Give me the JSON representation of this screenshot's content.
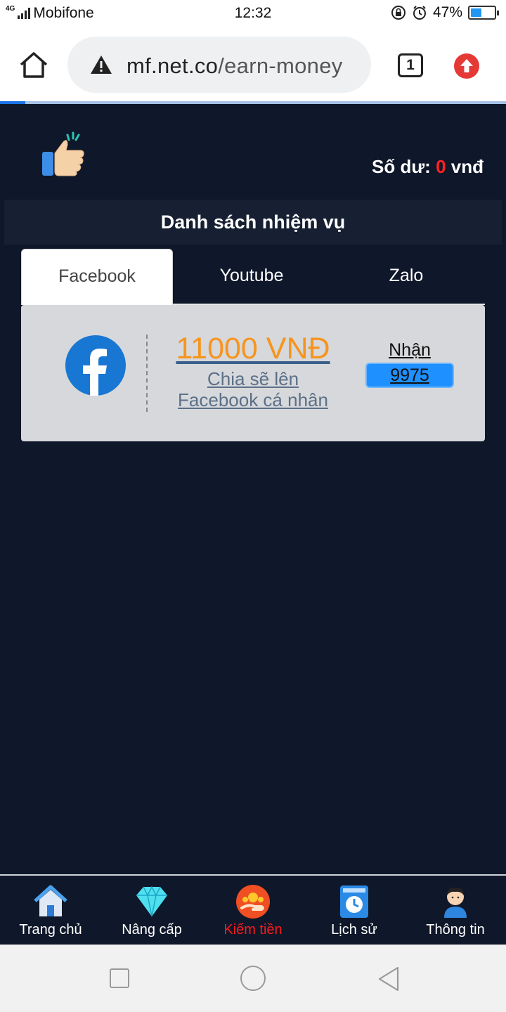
{
  "status_bar": {
    "network_type": "4G",
    "carrier": "Mobifone",
    "time": "12:32",
    "battery_percent": "47%",
    "battery_level": 0.47,
    "icons": [
      "signal-icon",
      "rotation-lock-icon",
      "alarm-icon",
      "battery-icon"
    ]
  },
  "browser": {
    "url_host": "mf.net.co",
    "url_path": "/earn-money",
    "tab_count": "1",
    "icons": [
      "home-icon",
      "not-secure-warning-icon",
      "tab-switcher-icon",
      "update-arrow-icon"
    ]
  },
  "header": {
    "balance_label": "Số dư:",
    "balance_value": "0",
    "balance_unit": "vnđ",
    "logo_icon": "thumbs-up-icon"
  },
  "page": {
    "title": "Danh sách nhiệm vụ"
  },
  "tabs": [
    {
      "label": "Facebook",
      "active": true
    },
    {
      "label": "Youtube",
      "active": false
    },
    {
      "label": "Zalo",
      "active": false
    }
  ],
  "task": {
    "platform_icon": "facebook-icon",
    "reward": "11000 VNĐ",
    "description_line1": "Chia sẽ lên",
    "description_line2": "Facebook cá nhân",
    "receive_label": "Nhận",
    "receive_count": "9975"
  },
  "bottom_nav": [
    {
      "label": "Trang chủ",
      "icon": "house-icon",
      "active": false
    },
    {
      "label": "Nâng cấp",
      "icon": "diamond-icon",
      "active": false
    },
    {
      "label": "Kiếm tiền",
      "icon": "coin-hand-icon",
      "active": true
    },
    {
      "label": "Lịch sử",
      "icon": "history-book-icon",
      "active": false
    },
    {
      "label": "Thông tin",
      "icon": "user-avatar-icon",
      "active": false
    }
  ],
  "colors": {
    "page_bg": "#0f172a",
    "title_bar_bg": "#162032",
    "reward_orange": "#f7941d",
    "balance_red": "#ff2222",
    "active_nav_red": "#ff1a1a",
    "receive_blue": "#1e90ff",
    "card_bg": "#d6d8db"
  }
}
